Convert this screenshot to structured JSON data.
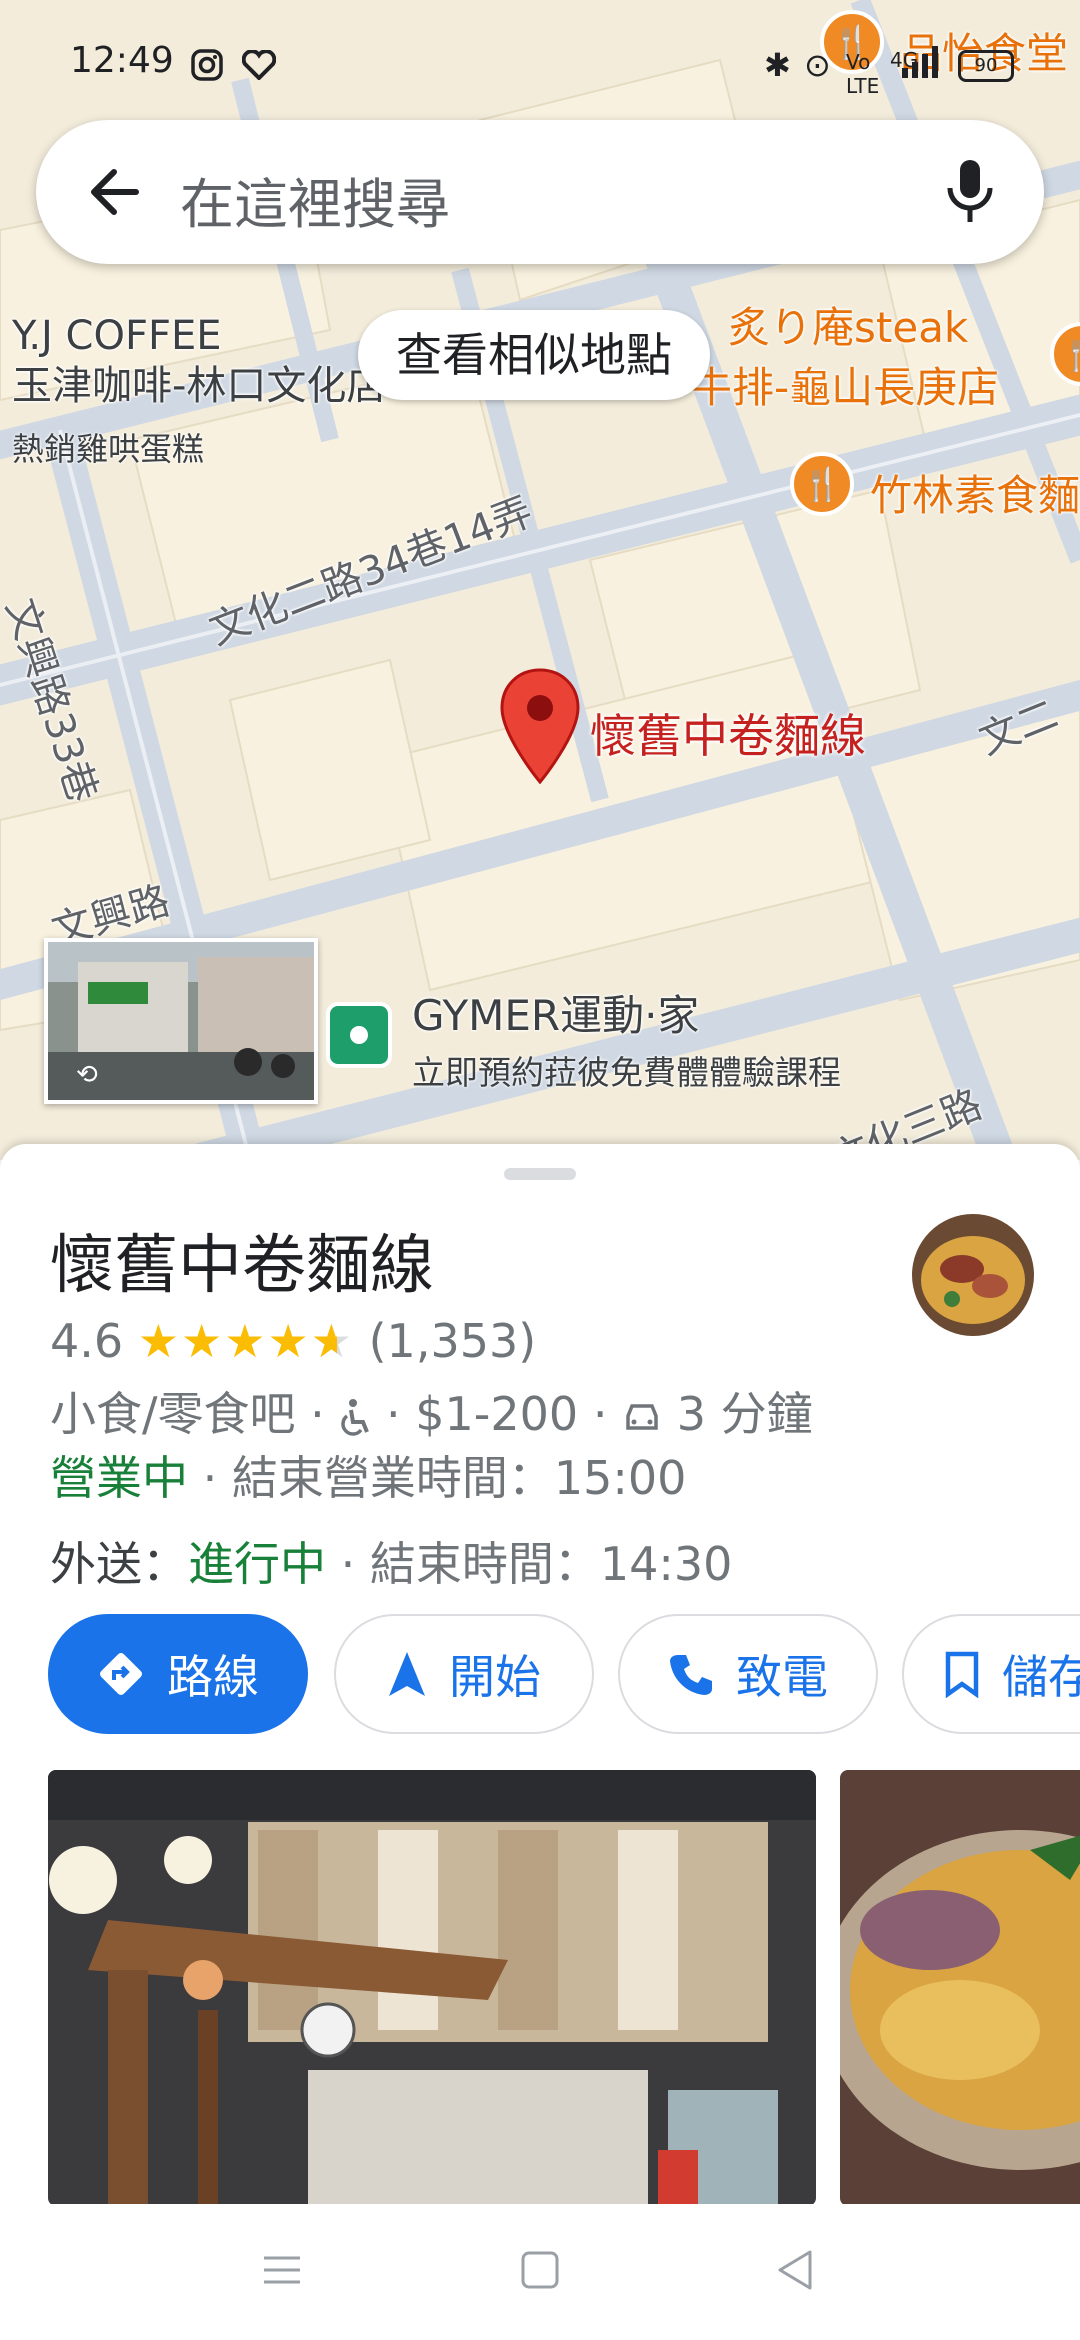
{
  "status_bar": {
    "time": "12:49",
    "network": "4G",
    "battery": "90"
  },
  "search": {
    "placeholder": "在這裡搜尋"
  },
  "map": {
    "similar_places_chip": "查看相似地點",
    "poi_yj_line1": "Y.J COFFEE",
    "poi_yj_line2": "玉津咖啡-林口文化店",
    "poi_yj_sub": "熱銷雞哄蛋糕",
    "poi_steak_line1": "炙り庵steak",
    "poi_steak_line2": "牛排-龜山長庚店",
    "poi_bamboo": "竹林素食麵",
    "poi_top_right": "品怡食堂",
    "road_wenhua2_lane": "文化二路34巷14弄",
    "road_wenxing33": "文興路33巷",
    "road_wenxing": "文興路",
    "road_wenhua3": "文化三路",
    "road_wen_right": "文二",
    "pin_label": "懷舊中卷麵線",
    "gym_name": "GYMER運動·家",
    "gym_promo": "立即預約菈彼免費體體驗課程"
  },
  "place": {
    "name": "懷舊中卷麵線",
    "rating": "4.6",
    "rating_value": 4.6,
    "review_count": "(1,353)",
    "category": "小食/零食吧",
    "price": "$1-200",
    "drive_time": "3 分鐘",
    "open_status": "營業中",
    "closing_text": "結束營業時間：15:00",
    "delivery_label": "外送：",
    "delivery_status": "進行中",
    "delivery_end": "結束時間：14:30",
    "separator": "·"
  },
  "actions": {
    "directions": "路線",
    "start": "開始",
    "call": "致電",
    "save": "儲存"
  },
  "colors": {
    "accent": "#1a73e8",
    "open_green": "#188038",
    "pin_red": "#ea4335",
    "star": "#fbbc04"
  }
}
